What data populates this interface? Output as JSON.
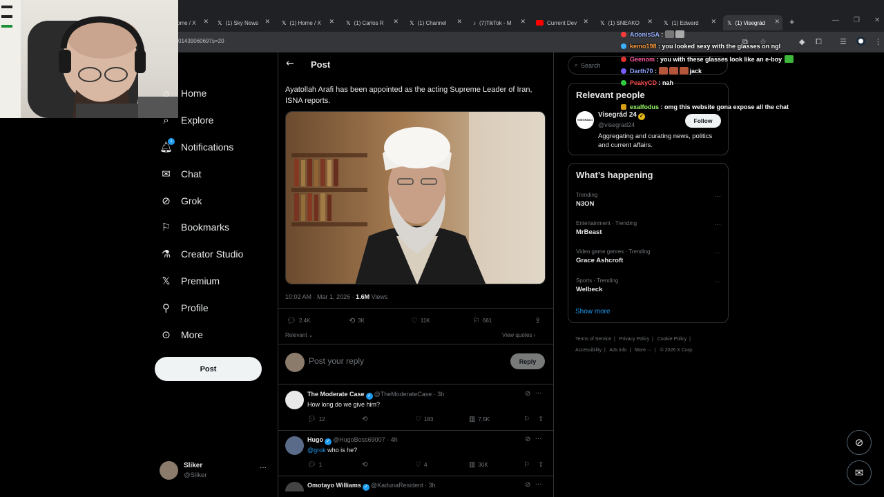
{
  "browser": {
    "tabs": [
      {
        "label": "ome / X",
        "icon": "x"
      },
      {
        "label": "(1) Sky News",
        "icon": "x"
      },
      {
        "label": "(1) Home / X",
        "icon": "x"
      },
      {
        "label": "(1) Carlos R",
        "icon": "x"
      },
      {
        "label": "(1) Channel",
        "icon": "x"
      },
      {
        "label": "(7)TikTok - M",
        "icon": "tiktok"
      },
      {
        "label": "Current Dev",
        "icon": "youtube"
      },
      {
        "label": "(1) SNEAKO",
        "icon": "x"
      },
      {
        "label": "(1) Edward",
        "icon": "x"
      },
      {
        "label": "(1) Visegrád",
        "icon": "x"
      }
    ],
    "url": "01439060697s=20"
  },
  "sidebar": {
    "items": [
      {
        "label": "Home",
        "icon": "home-icon"
      },
      {
        "label": "Explore",
        "icon": "search-icon"
      },
      {
        "label": "Notifications",
        "icon": "bell-icon",
        "badge": "1"
      },
      {
        "label": "Chat",
        "icon": "mail-icon"
      },
      {
        "label": "Grok",
        "icon": "grok-icon"
      },
      {
        "label": "Bookmarks",
        "icon": "bookmark-icon"
      },
      {
        "label": "Creator Studio",
        "icon": "flask-icon"
      },
      {
        "label": "Premium",
        "icon": "x-logo-icon"
      },
      {
        "label": "Profile",
        "icon": "person-icon"
      },
      {
        "label": "More",
        "icon": "more-circle-icon"
      }
    ],
    "post_label": "Post",
    "account": {
      "name": "Sliker",
      "handle": "@Sliker",
      "more": "···"
    }
  },
  "post": {
    "header": "Post",
    "text": "Ayatollah Arafi has been appointed as the acting Supreme Leader of Iran, ISNA reports.",
    "time": "10:02 AM · Mar 1, 2026 · ",
    "views_count": "1.6M",
    "views_label": " Views",
    "stats": {
      "replies": "2.4K",
      "reposts": "3K",
      "likes": "11K",
      "bookmarks": "661"
    },
    "relevant_label": "Relevant",
    "view_quotes": "View quotes",
    "reply_placeholder": "Post your reply",
    "reply_button": "Reply"
  },
  "replies": [
    {
      "name": "The Moderate Case",
      "handle": "@TheModerateCase · 3h",
      "mention": "",
      "text": "How long do we give him?",
      "replies": "12",
      "reposts": "",
      "likes": "183",
      "views": "7.5K"
    },
    {
      "name": "Hugo",
      "handle": "@HugoBoss69007 · 4h",
      "mention": "@grok",
      "text": " who is he?",
      "replies": "1",
      "reposts": "",
      "likes": "4",
      "views": "30K"
    },
    {
      "name": "Omotayo Williams",
      "handle": "@KadunaResident · 3h",
      "mention": "",
      "text": "",
      "replies": "",
      "reposts": "",
      "likes": "",
      "views": ""
    }
  ],
  "right": {
    "search_placeholder": "Search",
    "relevant_title": "Relevant people",
    "person": {
      "name": "Visegrád 24",
      "handle": "@visegrad24",
      "bio": "Aggregating and curating news, politics and current affairs.",
      "follow": "Follow",
      "avatar_text": "VISEGRAD24"
    },
    "happening_title": "What’s happening",
    "trends": [
      {
        "context": "Trending",
        "topic": "N3ON"
      },
      {
        "context": "Entertainment · Trending",
        "topic": "MrBeast"
      },
      {
        "context": "Video game genres · Trending",
        "topic": "Grace Ashcroft"
      },
      {
        "context": "Sports · Trending",
        "topic": "Welbeck"
      }
    ],
    "show_more": "Show more",
    "footer": [
      "Terms of Service",
      "Privacy Policy",
      "Cookie Policy",
      "Accessibility",
      "Ads info",
      "More ···",
      "© 2026 X Corp."
    ]
  },
  "chat": [
    {
      "user": "AdonisSA",
      "color": "#9ab4ff",
      "msg": ""
    },
    {
      "user": "kemo198",
      "color": "#ff9f43",
      "msg": "you looked sexy with the glasses on ngl"
    },
    {
      "user": "Geenom",
      "color": "#ff5aa0",
      "msg": "you with these glasses look like an e-boy"
    },
    {
      "user": "Darth70",
      "color": "#8fa6ff",
      "msg": "jack"
    },
    {
      "user": "PeakyCD",
      "color": "#ff4e4e",
      "msg": "nah"
    },
    {
      "user": "exalfodus",
      "color": "#9dff6a",
      "msg": "omg this website gona expose all the chat"
    }
  ],
  "colors": {
    "accent": "#1d9bf0",
    "background": "#000000",
    "border": "#2f3336",
    "muted": "#71767b"
  }
}
